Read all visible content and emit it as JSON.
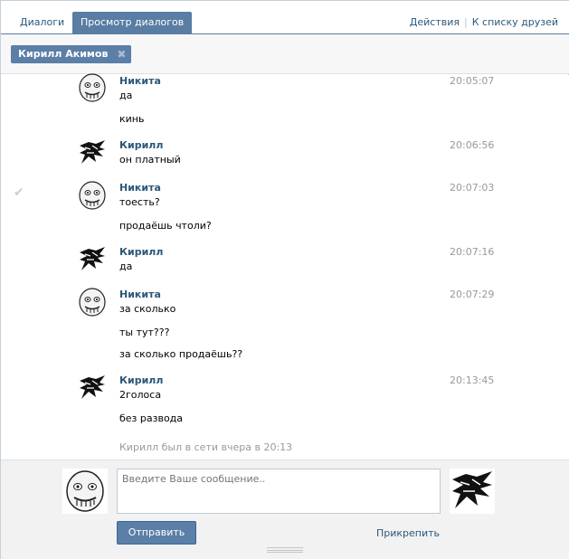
{
  "tabs": [
    {
      "label": "Диалоги"
    },
    {
      "label": "Просмотр диалогов"
    }
  ],
  "header_links": {
    "actions": "Действия",
    "friends": "К списку друзей",
    "separator": "|"
  },
  "peer_chip": {
    "name": "Кирилл Акимов",
    "close": "✖"
  },
  "messages": [
    {
      "author": "Никита",
      "time": "20:05:07",
      "lines": [
        "да",
        "кинь"
      ],
      "avatar": "meme-face-icon"
    },
    {
      "author": "Кирилл",
      "time": "20:06:56",
      "lines": [
        "он платный"
      ],
      "avatar": "tiger-icon"
    },
    {
      "author": "Никита",
      "time": "20:07:03",
      "lines": [
        "тоесть?",
        "продаёшь чтоли?"
      ],
      "avatar": "meme-face-icon"
    },
    {
      "author": "Кирилл",
      "time": "20:07:16",
      "lines": [
        "да"
      ],
      "avatar": "tiger-icon"
    },
    {
      "author": "Никита",
      "time": "20:07:29",
      "lines": [
        "за сколько",
        "ты тут???",
        "за сколько продаёшь??"
      ],
      "avatar": "meme-face-icon"
    },
    {
      "author": "Кирилл",
      "time": "20:13:45",
      "lines": [
        "2голоса",
        "без развода"
      ],
      "avatar": "tiger-icon"
    }
  ],
  "status": "Кирилл был в сети вчера в 20:13",
  "composer": {
    "placeholder": "Введите Ваше сообщение..",
    "send_label": "Отправить",
    "attach_label": "Прикрепить"
  },
  "colors": {
    "accent": "#5b7fa6",
    "link": "#2b587a",
    "time": "#999999"
  }
}
